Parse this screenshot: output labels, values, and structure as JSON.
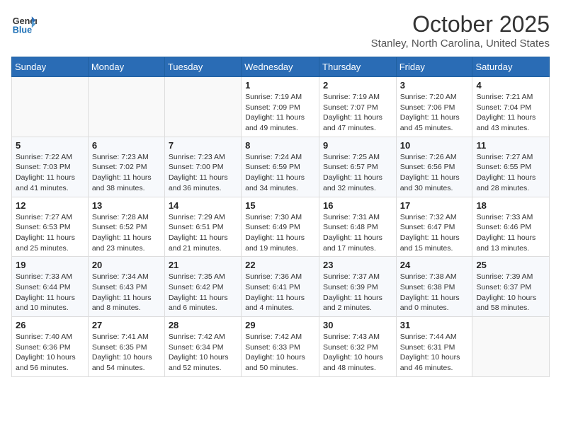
{
  "header": {
    "logo_line1": "General",
    "logo_line2": "Blue",
    "month_title": "October 2025",
    "location": "Stanley, North Carolina, United States"
  },
  "weekdays": [
    "Sunday",
    "Monday",
    "Tuesday",
    "Wednesday",
    "Thursday",
    "Friday",
    "Saturday"
  ],
  "weeks": [
    [
      {
        "day": "",
        "info": ""
      },
      {
        "day": "",
        "info": ""
      },
      {
        "day": "",
        "info": ""
      },
      {
        "day": "1",
        "info": "Sunrise: 7:19 AM\nSunset: 7:09 PM\nDaylight: 11 hours\nand 49 minutes."
      },
      {
        "day": "2",
        "info": "Sunrise: 7:19 AM\nSunset: 7:07 PM\nDaylight: 11 hours\nand 47 minutes."
      },
      {
        "day": "3",
        "info": "Sunrise: 7:20 AM\nSunset: 7:06 PM\nDaylight: 11 hours\nand 45 minutes."
      },
      {
        "day": "4",
        "info": "Sunrise: 7:21 AM\nSunset: 7:04 PM\nDaylight: 11 hours\nand 43 minutes."
      }
    ],
    [
      {
        "day": "5",
        "info": "Sunrise: 7:22 AM\nSunset: 7:03 PM\nDaylight: 11 hours\nand 41 minutes."
      },
      {
        "day": "6",
        "info": "Sunrise: 7:23 AM\nSunset: 7:02 PM\nDaylight: 11 hours\nand 38 minutes."
      },
      {
        "day": "7",
        "info": "Sunrise: 7:23 AM\nSunset: 7:00 PM\nDaylight: 11 hours\nand 36 minutes."
      },
      {
        "day": "8",
        "info": "Sunrise: 7:24 AM\nSunset: 6:59 PM\nDaylight: 11 hours\nand 34 minutes."
      },
      {
        "day": "9",
        "info": "Sunrise: 7:25 AM\nSunset: 6:57 PM\nDaylight: 11 hours\nand 32 minutes."
      },
      {
        "day": "10",
        "info": "Sunrise: 7:26 AM\nSunset: 6:56 PM\nDaylight: 11 hours\nand 30 minutes."
      },
      {
        "day": "11",
        "info": "Sunrise: 7:27 AM\nSunset: 6:55 PM\nDaylight: 11 hours\nand 28 minutes."
      }
    ],
    [
      {
        "day": "12",
        "info": "Sunrise: 7:27 AM\nSunset: 6:53 PM\nDaylight: 11 hours\nand 25 minutes."
      },
      {
        "day": "13",
        "info": "Sunrise: 7:28 AM\nSunset: 6:52 PM\nDaylight: 11 hours\nand 23 minutes."
      },
      {
        "day": "14",
        "info": "Sunrise: 7:29 AM\nSunset: 6:51 PM\nDaylight: 11 hours\nand 21 minutes."
      },
      {
        "day": "15",
        "info": "Sunrise: 7:30 AM\nSunset: 6:49 PM\nDaylight: 11 hours\nand 19 minutes."
      },
      {
        "day": "16",
        "info": "Sunrise: 7:31 AM\nSunset: 6:48 PM\nDaylight: 11 hours\nand 17 minutes."
      },
      {
        "day": "17",
        "info": "Sunrise: 7:32 AM\nSunset: 6:47 PM\nDaylight: 11 hours\nand 15 minutes."
      },
      {
        "day": "18",
        "info": "Sunrise: 7:33 AM\nSunset: 6:46 PM\nDaylight: 11 hours\nand 13 minutes."
      }
    ],
    [
      {
        "day": "19",
        "info": "Sunrise: 7:33 AM\nSunset: 6:44 PM\nDaylight: 11 hours\nand 10 minutes."
      },
      {
        "day": "20",
        "info": "Sunrise: 7:34 AM\nSunset: 6:43 PM\nDaylight: 11 hours\nand 8 minutes."
      },
      {
        "day": "21",
        "info": "Sunrise: 7:35 AM\nSunset: 6:42 PM\nDaylight: 11 hours\nand 6 minutes."
      },
      {
        "day": "22",
        "info": "Sunrise: 7:36 AM\nSunset: 6:41 PM\nDaylight: 11 hours\nand 4 minutes."
      },
      {
        "day": "23",
        "info": "Sunrise: 7:37 AM\nSunset: 6:39 PM\nDaylight: 11 hours\nand 2 minutes."
      },
      {
        "day": "24",
        "info": "Sunrise: 7:38 AM\nSunset: 6:38 PM\nDaylight: 11 hours\nand 0 minutes."
      },
      {
        "day": "25",
        "info": "Sunrise: 7:39 AM\nSunset: 6:37 PM\nDaylight: 10 hours\nand 58 minutes."
      }
    ],
    [
      {
        "day": "26",
        "info": "Sunrise: 7:40 AM\nSunset: 6:36 PM\nDaylight: 10 hours\nand 56 minutes."
      },
      {
        "day": "27",
        "info": "Sunrise: 7:41 AM\nSunset: 6:35 PM\nDaylight: 10 hours\nand 54 minutes."
      },
      {
        "day": "28",
        "info": "Sunrise: 7:42 AM\nSunset: 6:34 PM\nDaylight: 10 hours\nand 52 minutes."
      },
      {
        "day": "29",
        "info": "Sunrise: 7:42 AM\nSunset: 6:33 PM\nDaylight: 10 hours\nand 50 minutes."
      },
      {
        "day": "30",
        "info": "Sunrise: 7:43 AM\nSunset: 6:32 PM\nDaylight: 10 hours\nand 48 minutes."
      },
      {
        "day": "31",
        "info": "Sunrise: 7:44 AM\nSunset: 6:31 PM\nDaylight: 10 hours\nand 46 minutes."
      },
      {
        "day": "",
        "info": ""
      }
    ]
  ]
}
